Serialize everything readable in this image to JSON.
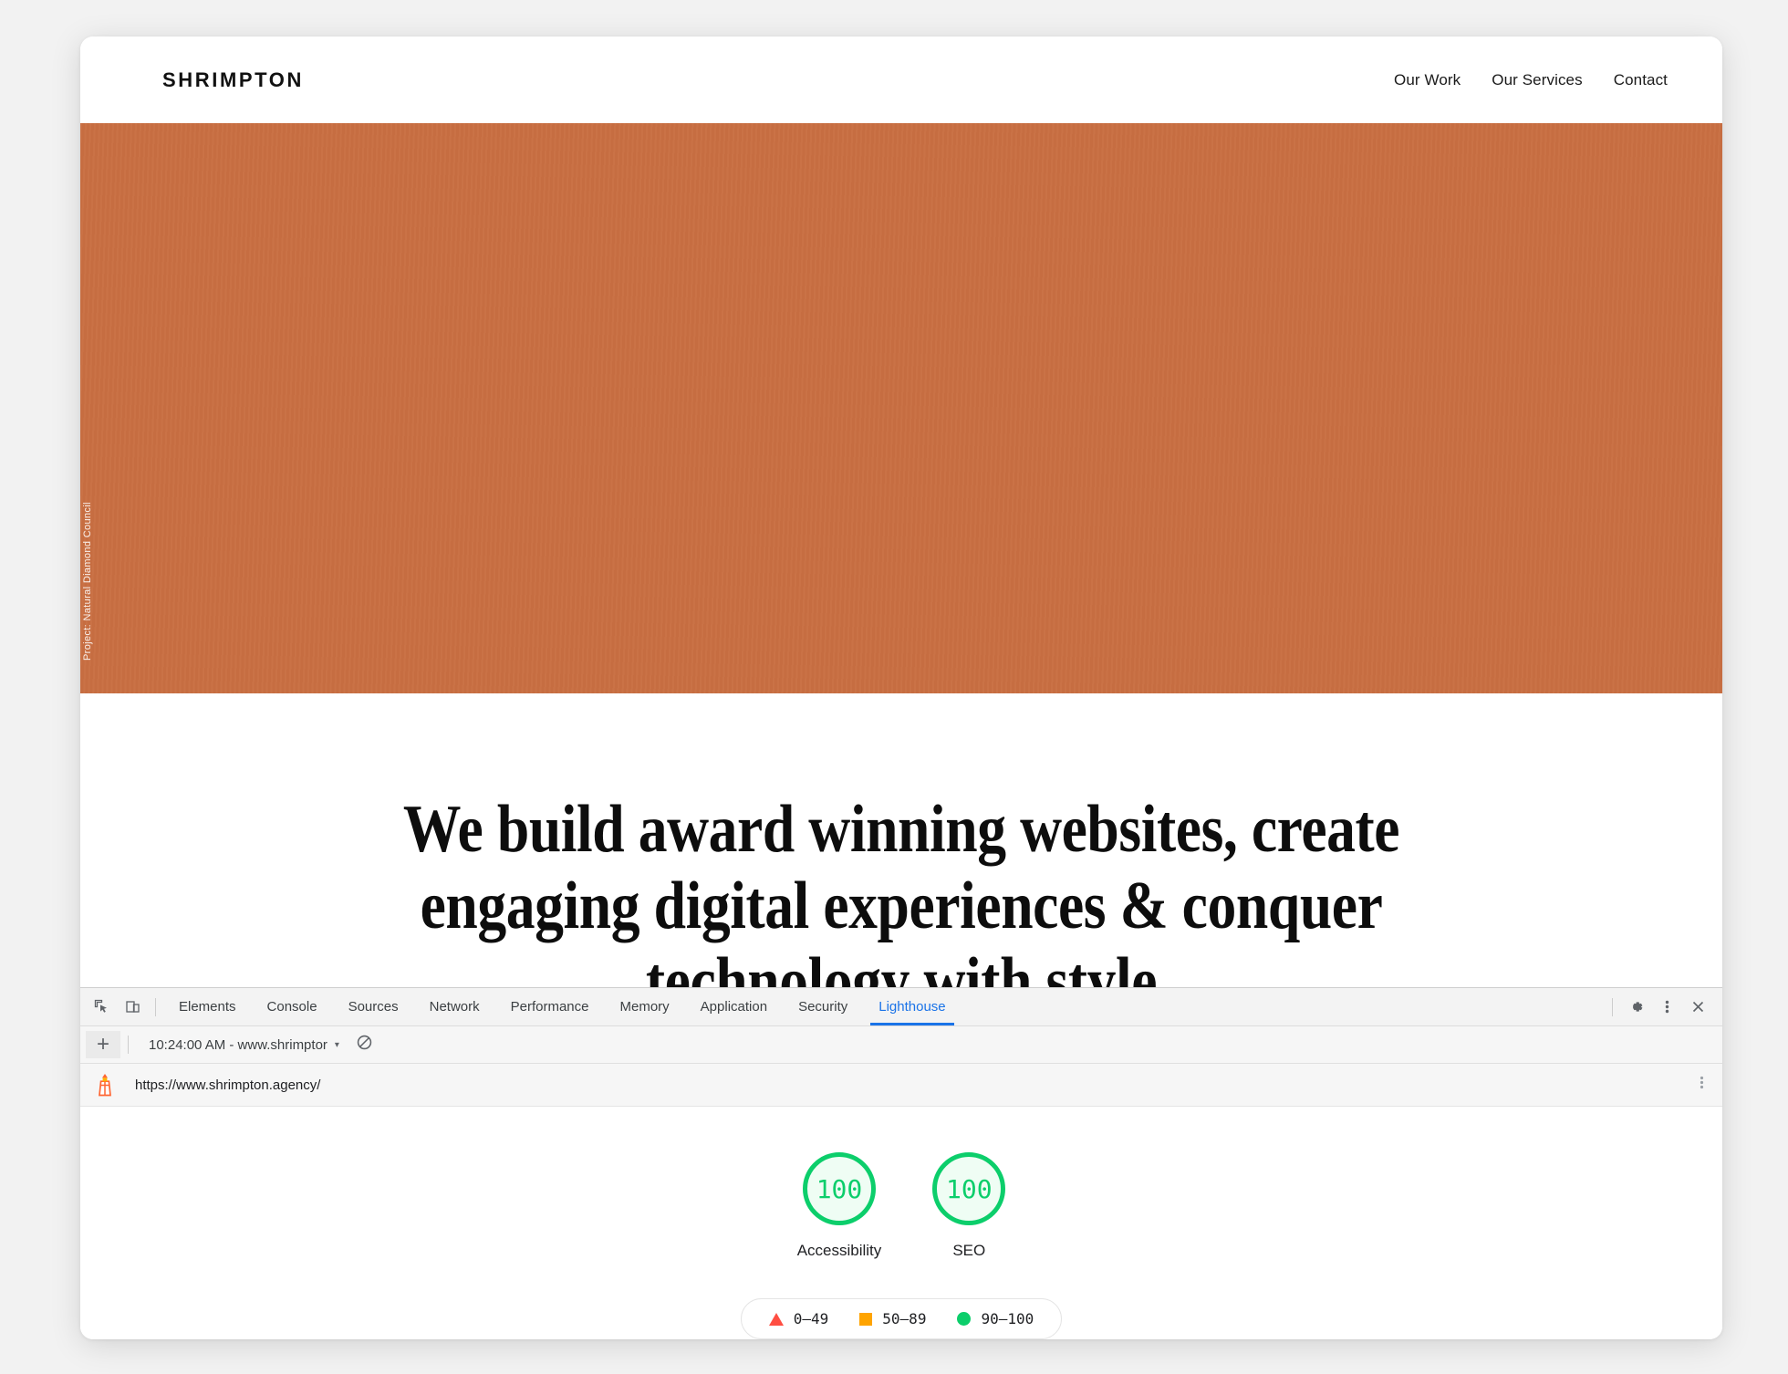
{
  "site": {
    "brand": "SHRIMPTON",
    "nav": [
      {
        "label": "Our Work"
      },
      {
        "label": "Our Services"
      },
      {
        "label": "Contact"
      }
    ],
    "hero": {
      "credit": "Project: Natural Diamond Council"
    },
    "headline": "We build award winning websites, create engaging digital experiences & conquer technology with style"
  },
  "devtools": {
    "icons": {
      "inspect": "inspect-element-icon",
      "device": "device-toolbar-icon",
      "settings": "gear-icon",
      "more": "more-vertical-icon",
      "close": "close-icon"
    },
    "tabs": [
      {
        "label": "Elements",
        "active": false
      },
      {
        "label": "Console",
        "active": false
      },
      {
        "label": "Sources",
        "active": false
      },
      {
        "label": "Network",
        "active": false
      },
      {
        "label": "Performance",
        "active": false
      },
      {
        "label": "Memory",
        "active": false
      },
      {
        "label": "Application",
        "active": false
      },
      {
        "label": "Security",
        "active": false
      },
      {
        "label": "Lighthouse",
        "active": true
      }
    ],
    "active_tab": "Lighthouse",
    "accent_color": "#1a73e8",
    "subbar": {
      "add_label": "+",
      "run_selector": "10:24:00 AM - www.shrimptor",
      "caret": "▾",
      "clear_icon": "no-entry-icon"
    },
    "urlbar": {
      "url": "https://www.shrimpton.agency/",
      "logo_icon": "lighthouse-icon",
      "menu_icon": "more-vertical-icon"
    }
  },
  "report": {
    "gauges": [
      {
        "score": "100",
        "label": "Accessibility",
        "color": "#0CCE6B"
      },
      {
        "score": "100",
        "label": "SEO",
        "color": "#0CCE6B"
      }
    ],
    "legend": [
      {
        "shape": "triangle",
        "range": "0–49",
        "color": "#ff4e42"
      },
      {
        "shape": "square",
        "range": "50–89",
        "color": "#ffa400"
      },
      {
        "shape": "circle",
        "range": "90–100",
        "color": "#0CCE6B"
      }
    ]
  }
}
